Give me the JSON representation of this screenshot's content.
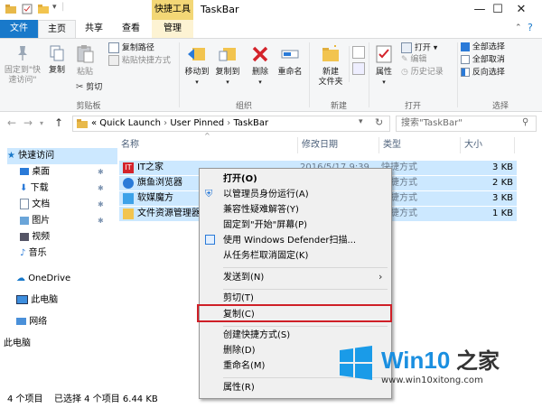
{
  "window": {
    "title": "TaskBar",
    "contextual_tab_group": "快捷工具",
    "controls": {
      "minimize": "—",
      "maximize": "☐",
      "close": "✕"
    }
  },
  "tabs": [
    {
      "label": "文件"
    },
    {
      "label": "主页"
    },
    {
      "label": "共享"
    },
    {
      "label": "查看"
    },
    {
      "label": "管理"
    }
  ],
  "ribbon": {
    "clipboard": {
      "pin": "固定到\"快\n速访问\"",
      "copy": "复制",
      "paste": "粘贴",
      "copy_path": "复制路径",
      "paste_shortcut": "粘贴快捷方式",
      "cut": "剪切",
      "group": "剪贴板"
    },
    "organize": {
      "move_to": "移动到",
      "copy_to": "复制到",
      "delete": "删除",
      "rename": "重命名",
      "group": "组织"
    },
    "new": {
      "new_folder": "新建\n文件夹",
      "group": "新建"
    },
    "open": {
      "properties": "属性",
      "open": "打开",
      "edit": "编辑",
      "history": "历史记录",
      "group": "打开"
    },
    "select": {
      "select_all": "全部选择",
      "select_none": "全部取消",
      "invert": "反向选择",
      "group": "选择"
    }
  },
  "address": {
    "breadcrumb": [
      "«  Quick Launch",
      "User Pinned",
      "TaskBar"
    ],
    "search_placeholder": "搜索\"TaskBar\""
  },
  "navpane": {
    "quick_access": "快速访问",
    "items": [
      {
        "label": "桌面",
        "pinned": true
      },
      {
        "label": "下载",
        "pinned": true
      },
      {
        "label": "文档",
        "pinned": true
      },
      {
        "label": "图片",
        "pinned": true
      },
      {
        "label": "视频",
        "pinned": false
      },
      {
        "label": "音乐",
        "pinned": false
      }
    ],
    "onedrive": "OneDrive",
    "this_pc": "此电脑",
    "network": "网络",
    "homegroup": "此电脑"
  },
  "filelist": {
    "columns": [
      "名称",
      "修改日期",
      "类型",
      "大小"
    ],
    "rows": [
      {
        "name": "IT之家",
        "date": "2016/5/17 9:39",
        "type": "快捷方式",
        "size": "3 KB"
      },
      {
        "name": "旗鱼浏览器",
        "date": "",
        "type": "快捷方式",
        "size": "2 KB"
      },
      {
        "name": "软媒魔方",
        "date": "",
        "type": "快捷方式",
        "size": "3 KB"
      },
      {
        "name": "文件资源管理器",
        "date": "",
        "type": "快捷方式",
        "size": "1 KB"
      }
    ]
  },
  "context_menu": [
    {
      "label": "打开(O)",
      "bold": true
    },
    {
      "label": "以管理员身份运行(A)"
    },
    {
      "label": "兼容性疑难解答(Y)"
    },
    {
      "label": "固定到\"开始\"屏幕(P)"
    },
    {
      "label": "使用 Windows Defender扫描..."
    },
    {
      "label": "从任务栏取消固定(K)"
    },
    {
      "label": "发送到(N)"
    },
    {
      "label": "剪切(T)"
    },
    {
      "label": "复制(C)"
    },
    {
      "label": "创建快捷方式(S)"
    },
    {
      "label": "删除(D)"
    },
    {
      "label": "重命名(M)"
    },
    {
      "label": "属性(R)"
    }
  ],
  "status": {
    "count": "4 个项目",
    "selected": "已选择 4 个项目  6.44 KB"
  },
  "watermark": {
    "brand_prefix": "Win10",
    "brand_suffix": " 之家",
    "url": "www.win10xitong.com"
  },
  "colors": {
    "accent": "#1979ca",
    "selection": "#cce8ff",
    "highlight_border": "#cf1f27",
    "contextual": "#f3d776"
  }
}
